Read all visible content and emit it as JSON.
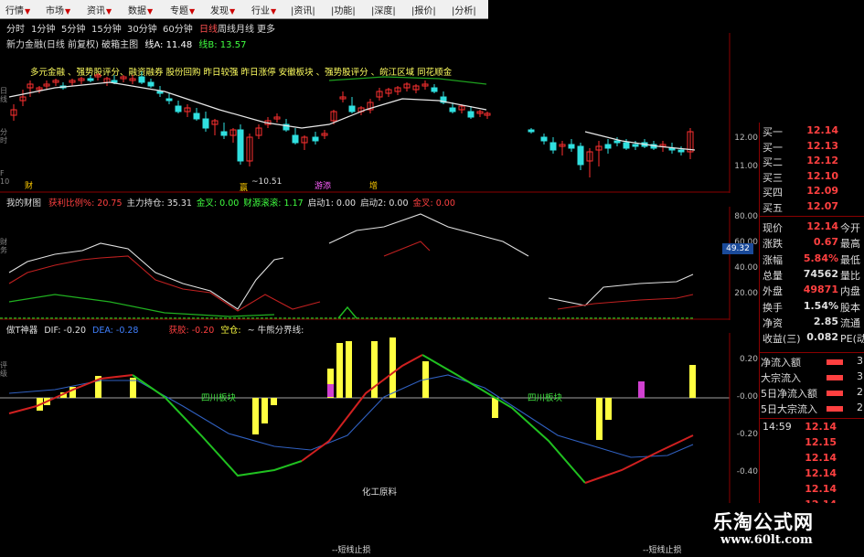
{
  "toolbar": {
    "items": [
      "行情",
      "市场",
      "资讯",
      "数据",
      "专题",
      "发现",
      "行业",
      "|资讯|",
      "|功能|",
      "|深度|",
      "|报价|",
      "|分析|"
    ]
  },
  "periods": {
    "items": [
      "分时",
      "1分钟",
      "5分钟",
      "15分钟",
      "30分钟",
      "60分钟",
      "日线",
      "周线",
      "月线",
      "更多"
    ],
    "active_index": 6
  },
  "main_chart": {
    "title": "新力金融(日线 前复权) 破箱主图",
    "indicator_a": "线A: 11.48",
    "indicator_b": "线B: 13.57",
    "concept_tags": "多元金融 、强势股评分、融资融券 股份回购 昨日较强 昨日涨停 安徽板块 、强势股评分 、皖江区域 同花顺金",
    "low_label": "~10.51",
    "markers": [
      "财",
      "赢",
      "游添",
      "增"
    ],
    "yticks": [
      "12.00",
      "11.00"
    ]
  },
  "indicator_panel_1": {
    "name": "我的财图",
    "items": [
      {
        "label": "获利比例%:",
        "value": "20.75",
        "color": "#ff4040"
      },
      {
        "label": "主力持仓:",
        "value": "35.31",
        "color": "#e0e0e0"
      },
      {
        "label": "金叉:",
        "value": "0.00",
        "color": "#40ff40"
      },
      {
        "label": "财源滚滚:",
        "value": "1.17",
        "color": "#40ff40"
      },
      {
        "label": "启动1:",
        "value": "0.00",
        "color": "#e0e0e0"
      },
      {
        "label": "启动2:",
        "value": "0.00",
        "color": "#e0e0e0"
      },
      {
        "label": "金叉:",
        "value": "0.00",
        "color": "#ff4040"
      }
    ],
    "yticks": [
      "80.00",
      "60.00",
      "40.00",
      "20.00"
    ],
    "marker_value": "49.32"
  },
  "indicator_panel_2": {
    "name": "做T神器",
    "dif": "DIF: -0.20",
    "dea": "DEA: -0.28",
    "prefix_red": "获胶: -0.20",
    "kongcang": "空仓:",
    "niuxiong": "~ 牛熊分界线:",
    "label_left": "四川板块",
    "label_right": "四川板块",
    "bottom_label": "化工原料",
    "stop_left": "--短线止损",
    "stop_right": "--短线止损",
    "yticks": [
      "0.20",
      "-0.00",
      "-0.20",
      "-0.40"
    ]
  },
  "quote_panel": {
    "buy_rows": [
      {
        "label": "买一",
        "value": "12.14"
      },
      {
        "label": "买一",
        "value": "12.13"
      },
      {
        "label": "买二",
        "value": "12.12"
      },
      {
        "label": "买三",
        "value": "12.10"
      },
      {
        "label": "买四",
        "value": "12.09"
      },
      {
        "label": "买五",
        "value": "12.07"
      }
    ],
    "stats": [
      {
        "label": "现价",
        "value": "12.14",
        "tail": "今开",
        "color": "#ff4040"
      },
      {
        "label": "涨跌",
        "value": "0.67",
        "tail": "最高",
        "color": "#ff4040"
      },
      {
        "label": "涨幅",
        "value": "5.84%",
        "tail": "最低",
        "color": "#ff4040"
      },
      {
        "label": "总量",
        "value": "74562",
        "tail": "量比",
        "color": "#e0e0e0"
      },
      {
        "label": "外盘",
        "value": "49871",
        "tail": "内盘",
        "color": "#ff4040"
      },
      {
        "label": "换手",
        "value": "1.54%",
        "tail": "股本",
        "color": "#e0e0e0"
      },
      {
        "label": "净资",
        "value": "2.85",
        "tail": "流通",
        "color": "#e0e0e0"
      },
      {
        "label": "收益(三)",
        "value": "0.082",
        "tail": "PE(动)",
        "color": "#e0e0e0"
      }
    ],
    "flows": [
      {
        "label": "净流入额",
        "tail": "3"
      },
      {
        "label": "大宗流入",
        "tail": "3"
      },
      {
        "label": "5日净流入额",
        "tail": "2"
      },
      {
        "label": "5日大宗流入",
        "tail": "2"
      }
    ],
    "ticks": [
      {
        "time": "14:59",
        "price": "12.14"
      },
      {
        "time": "",
        "price": "12.15"
      },
      {
        "time": "",
        "price": "12.14"
      },
      {
        "time": "",
        "price": "12.14"
      },
      {
        "time": "",
        "price": "12.14"
      },
      {
        "time": "",
        "price": "12.14"
      },
      {
        "time": "",
        "price": "12.14"
      }
    ]
  },
  "watermark": {
    "title": "乐淘公式网",
    "url": "www.60lt.com"
  },
  "colors": {
    "up": "#ff3030",
    "down": "#30e0e0",
    "bg": "#000000",
    "grid": "#8b0000"
  }
}
